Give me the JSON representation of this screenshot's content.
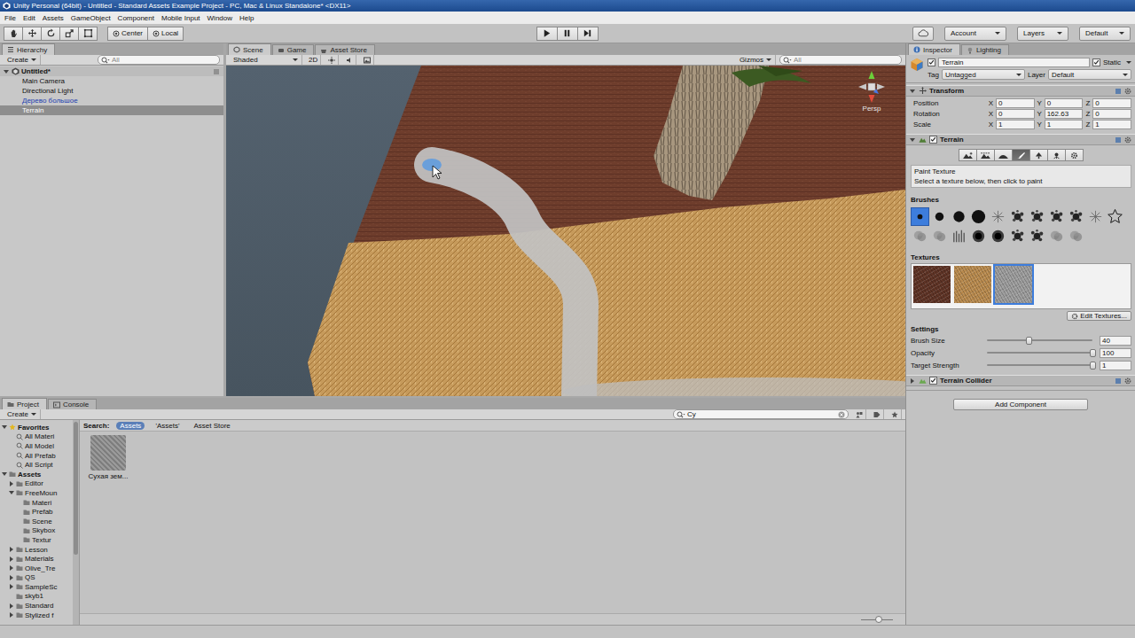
{
  "window": {
    "title": "Unity Personal (64bit) - Untitled - Standard Assets Example Project - PC, Mac & Linux Standalone* <DX11>"
  },
  "menu": [
    "File",
    "Edit",
    "Assets",
    "GameObject",
    "Component",
    "Mobile Input",
    "Window",
    "Help"
  ],
  "toolbar": {
    "tools": [
      {
        "kind": "hand",
        "selected": false
      },
      {
        "kind": "move",
        "selected": false
      },
      {
        "kind": "rotate",
        "selected": false
      },
      {
        "kind": "scale",
        "selected": false
      },
      {
        "kind": "rect",
        "selected": false
      }
    ],
    "pivot": [
      "Center",
      "Local"
    ],
    "playback": [
      {
        "kind": "play",
        "selected": false
      },
      {
        "kind": "pause",
        "selected": false
      },
      {
        "kind": "step",
        "selected": false
      }
    ],
    "account": "Account",
    "layers": "Layers",
    "layout": "Default"
  },
  "hierarchy": {
    "tab": "Hierarchy",
    "create": "Create",
    "search": {
      "placeholder": "All"
    },
    "items": [
      {
        "label": "Untitled*",
        "depth": 0,
        "expandable": true,
        "expanded": true,
        "prefab": false,
        "selected": false
      },
      {
        "label": "Main Camera",
        "depth": 1,
        "expandable": false,
        "expanded": false,
        "prefab": false,
        "selected": false
      },
      {
        "label": "Directional Light",
        "depth": 1,
        "expandable": false,
        "expanded": false,
        "prefab": false,
        "selected": false
      },
      {
        "label": "Дерево большое",
        "depth": 1,
        "expandable": false,
        "expanded": false,
        "prefab": true,
        "selected": false
      },
      {
        "label": "Terrain",
        "depth": 1,
        "expandable": false,
        "expanded": false,
        "prefab": false,
        "selected": true
      }
    ]
  },
  "scene": {
    "tabs": [
      {
        "label": "Scene",
        "selected": true
      },
      {
        "label": "Game",
        "selected": false
      },
      {
        "label": "Asset Store",
        "selected": false
      }
    ],
    "shading": "Shaded",
    "mode_2d": {
      "label": "2D",
      "selected": false
    },
    "gizmos": "Gizmos",
    "search": {
      "placeholder": "All"
    },
    "projection": "Persp"
  },
  "inspector": {
    "tabs": [
      {
        "label": "Inspector",
        "selected": true
      },
      {
        "label": "Lighting",
        "selected": false
      }
    ],
    "object": {
      "name": "Terrain",
      "active": true,
      "static_label": "Static",
      "static": true,
      "tag_label": "Tag",
      "tag": "Untagged",
      "layer_label": "Layer",
      "layer": "Default"
    },
    "transform": {
      "title": "Transform",
      "expanded": true,
      "axes": [
        "X",
        "Y",
        "Z"
      ],
      "rows": [
        {
          "label": "Position",
          "x": "0",
          "y": "0",
          "z": "0"
        },
        {
          "label": "Rotation",
          "x": "0",
          "y": "162.63",
          "z": "0"
        },
        {
          "label": "Scale",
          "x": "1",
          "y": "1",
          "z": "1"
        }
      ]
    },
    "terrain": {
      "title": "Terrain",
      "enabled": true,
      "expanded": true,
      "tools": [
        {
          "kind": "raise",
          "selected": false
        },
        {
          "kind": "height",
          "selected": false
        },
        {
          "kind": "smooth",
          "selected": false
        },
        {
          "kind": "paint",
          "selected": true
        },
        {
          "kind": "trees",
          "selected": false
        },
        {
          "kind": "details",
          "selected": false
        },
        {
          "kind": "settings",
          "selected": false
        }
      ],
      "mode_title": "Paint Texture",
      "mode_hint": "Select a texture below, then click to paint",
      "brushes_label": "Brushes",
      "brushes": [
        {
          "kind": "circle-s",
          "selected": true
        },
        {
          "kind": "circle-m",
          "selected": false
        },
        {
          "kind": "circle-l",
          "selected": false
        },
        {
          "kind": "circle-xl",
          "selected": false
        },
        {
          "kind": "spark",
          "selected": false
        },
        {
          "kind": "splat",
          "selected": false
        },
        {
          "kind": "splat",
          "selected": false
        },
        {
          "kind": "splat",
          "selected": false
        },
        {
          "kind": "splat",
          "selected": false
        },
        {
          "kind": "spark",
          "selected": false
        },
        {
          "kind": "star",
          "selected": false
        },
        {
          "kind": "cloud",
          "selected": false
        },
        {
          "kind": "cloud",
          "selected": false
        },
        {
          "kind": "grass",
          "selected": false
        },
        {
          "kind": "blob",
          "selected": false
        },
        {
          "kind": "blob",
          "selected": false
        },
        {
          "kind": "splat",
          "selected": false
        },
        {
          "kind": "splat",
          "selected": false
        },
        {
          "kind": "cloud",
          "selected": false
        },
        {
          "kind": "cloud",
          "selected": false
        }
      ],
      "textures_label": "Textures",
      "textures": [
        {
          "color": "#5e3325",
          "selected": false
        },
        {
          "color": "#b88a4e",
          "selected": false
        },
        {
          "color": "#9c9c9c",
          "selected": true
        }
      ],
      "edit_textures": "Edit Textures...",
      "settings_label": "Settings",
      "settings": [
        {
          "label": "Brush Size",
          "value": "40",
          "level": 0.4
        },
        {
          "label": "Opacity",
          "value": "100",
          "level": 1
        },
        {
          "label": "Target Strength",
          "value": "1",
          "level": 1
        }
      ]
    },
    "collider": {
      "title": "Terrain Collider",
      "enabled": true,
      "expanded": false
    },
    "add_component": "Add Component"
  },
  "project": {
    "tabs": [
      {
        "label": "Project",
        "selected": true
      },
      {
        "label": "Console",
        "selected": false
      }
    ],
    "create": "Create",
    "search": {
      "value": "Су"
    },
    "search_scope": {
      "label": "Search:",
      "options": [
        {
          "label": "Assets",
          "selected": true
        },
        {
          "label": "'Assets'",
          "selected": false
        },
        {
          "label": "Asset Store",
          "selected": false
        }
      ]
    },
    "tree": [
      {
        "label": "Favorites",
        "depth": 0,
        "kind": "favorites",
        "expandable": true,
        "expanded": true
      },
      {
        "label": "All Materi",
        "depth": 1,
        "kind": "search",
        "expandable": false,
        "expanded": false
      },
      {
        "label": "All Model",
        "depth": 1,
        "kind": "search",
        "expandable": false,
        "expanded": false
      },
      {
        "label": "All Prefab",
        "depth": 1,
        "kind": "search",
        "expandable": false,
        "expanded": false
      },
      {
        "label": "All Script",
        "depth": 1,
        "kind": "search",
        "expandable": false,
        "expanded": false
      },
      {
        "label": "Assets",
        "depth": 0,
        "kind": "root",
        "expandable": true,
        "expanded": true
      },
      {
        "label": "Editor",
        "depth": 1,
        "kind": "folder",
        "expandable": true,
        "expanded": false
      },
      {
        "label": "FreeMoun",
        "depth": 1,
        "kind": "folder",
        "expandable": true,
        "expanded": true
      },
      {
        "label": "Materi",
        "depth": 2,
        "kind": "folder",
        "expandable": false,
        "expanded": false
      },
      {
        "label": "Prefab",
        "depth": 2,
        "kind": "folder",
        "expandable": false,
        "expanded": false
      },
      {
        "label": "Scene",
        "depth": 2,
        "kind": "folder",
        "expandable": false,
        "expanded": false
      },
      {
        "label": "Skybox",
        "depth": 2,
        "kind": "folder",
        "expandable": false,
        "expanded": false
      },
      {
        "label": "Textur",
        "depth": 2,
        "kind": "folder",
        "expandable": false,
        "expanded": false
      },
      {
        "label": "Lesson",
        "depth": 1,
        "kind": "folder",
        "expandable": true,
        "expanded": false
      },
      {
        "label": "Materials",
        "depth": 1,
        "kind": "folder",
        "expandable": true,
        "expanded": false
      },
      {
        "label": "Olive_Tre",
        "depth": 1,
        "kind": "folder",
        "expandable": true,
        "expanded": false
      },
      {
        "label": "QS",
        "depth": 1,
        "kind": "folder",
        "expandable": true,
        "expanded": false
      },
      {
        "label": "SampleSc",
        "depth": 1,
        "kind": "folder",
        "expandable": true,
        "expanded": false
      },
      {
        "label": "skyb1",
        "depth": 1,
        "kind": "folder",
        "expandable": false,
        "expanded": false
      },
      {
        "label": "Standard",
        "depth": 1,
        "kind": "folder",
        "expandable": true,
        "expanded": false
      },
      {
        "label": "Stylized f",
        "depth": 1,
        "kind": "folder",
        "expandable": true,
        "expanded": false
      }
    ],
    "assets": [
      {
        "label": "Сухая зем...",
        "selected": false
      }
    ],
    "size_slider": {
      "level": 0.55
    }
  }
}
